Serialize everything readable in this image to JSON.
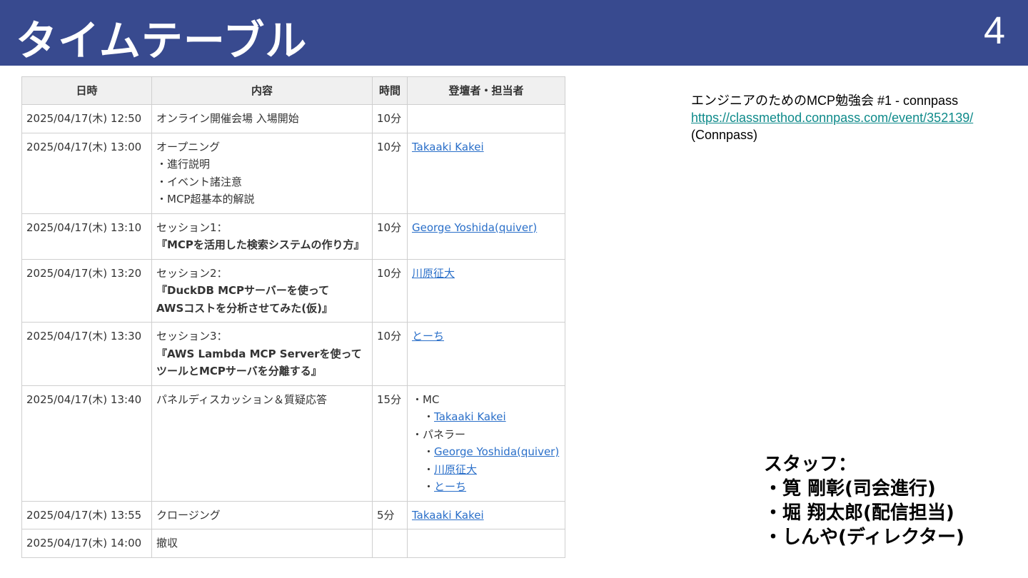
{
  "header": {
    "title": "タイムテーブル",
    "page_number": "4"
  },
  "table": {
    "columns": [
      "日時",
      "内容",
      "時間",
      "登壇者・担当者"
    ],
    "rows": [
      {
        "datetime": "2025/04/17(木) 12:50",
        "content": [
          "オンライン開催会場 入場開始"
        ],
        "duration": "10分",
        "persons": []
      },
      {
        "datetime": "2025/04/17(木) 13:00",
        "content": [
          "オープニング",
          "・進行説明",
          "・イベント諸注意",
          "・MCP超基本的解説"
        ],
        "duration": "10分",
        "persons": [
          "Takaaki Kakei"
        ]
      },
      {
        "datetime": "2025/04/17(木) 13:10",
        "content": [
          "セッション1：",
          "『MCPを活用した検索システムの作り方』"
        ],
        "duration": "10分",
        "persons": [
          "George Yoshida(quiver)"
        ]
      },
      {
        "datetime": "2025/04/17(木) 13:20",
        "content": [
          "セッション2：",
          "『DuckDB MCPサーバーを使って",
          "AWSコストを分析させてみた(仮)』"
        ],
        "duration": "10分",
        "persons": [
          "川原征大"
        ]
      },
      {
        "datetime": "2025/04/17(木) 13:30",
        "content": [
          "セッション3：",
          "『AWS Lambda MCP Serverを使って",
          "ツールとMCPサーバを分離する』"
        ],
        "duration": "10分",
        "persons": [
          "とーち"
        ]
      },
      {
        "datetime": "2025/04/17(木) 13:40",
        "content": [
          "パネルディスカッション＆質疑応答"
        ],
        "duration": "15分",
        "persons_detail": {
          "mc_label": "・MC",
          "mc": [
            "Takaaki Kakei"
          ],
          "panel_label": "・パネラー",
          "panel": [
            "George Yoshida(quiver)",
            "川原征大",
            "とーち"
          ],
          "bullet": "・"
        }
      },
      {
        "datetime": "2025/04/17(木) 13:55",
        "content": [
          "クロージング"
        ],
        "duration": "5分",
        "persons": [
          "Takaaki Kakei"
        ]
      },
      {
        "datetime": "2025/04/17(木) 14:00",
        "content": [
          "撤収"
        ],
        "duration": "",
        "persons": []
      }
    ]
  },
  "info": {
    "event_title": "エンジニアのためのMCP勉強会 #1 - connpass",
    "event_url": "https://classmethod.connpass.com/event/352139/",
    "source": "(Connpass)"
  },
  "staff": {
    "heading": "スタッフ：",
    "members": [
      "・筧 剛彰(司会進行)",
      "・堀 翔太郎(配信担当)",
      "・しんや(ディレクター)"
    ]
  },
  "colors": {
    "header_bg": "#384a8f",
    "link": "#2a6fc9",
    "url_link": "#0e8a8a",
    "table_header_bg": "#f0f0f0"
  }
}
